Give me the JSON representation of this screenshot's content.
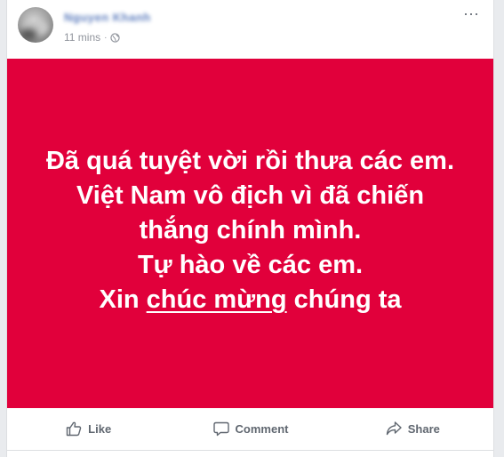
{
  "post": {
    "author_name": "Nguyen Khanh",
    "timestamp": "11 mins",
    "separator": "·",
    "privacy_icon": "globe-icon",
    "menu_glyph": "···",
    "menu_icon": "more-options-icon"
  },
  "banner": {
    "background_color": "#e1003b",
    "text_color": "#ffffff",
    "line1": "Đã quá tuyệt vời rồi thưa các em.",
    "line2": "Việt Nam vô địch vì đã chiến thắng chính mình.",
    "line3": "Tự hào về các em.",
    "line4_prefix": "Xin ",
    "line4_underlined": "chúc mừng",
    "line4_suffix": " chúng ta"
  },
  "actions": {
    "like_label": "Like",
    "like_icon": "thumbs-up-icon",
    "comment_label": "Comment",
    "comment_icon": "comment-bubble-icon",
    "share_label": "Share",
    "share_icon": "share-arrow-icon"
  }
}
